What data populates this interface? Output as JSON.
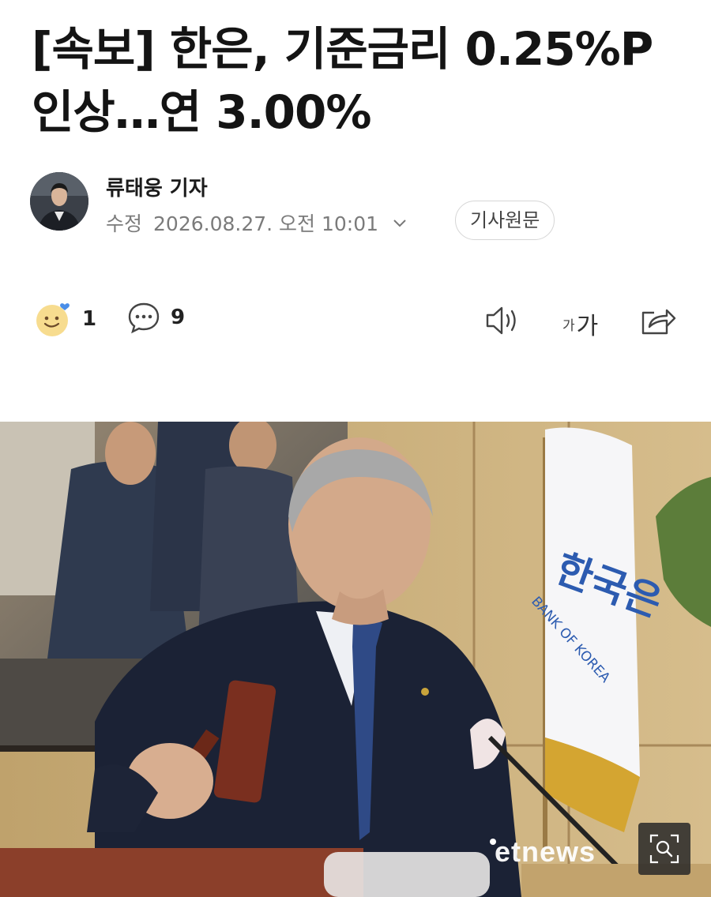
{
  "article": {
    "headline_line1": "[속보] 한은, 기준금리 0.25%P",
    "headline_line2": "인상…연 3.00%"
  },
  "byline": {
    "reporter": "류태웅 기자",
    "edit_label": "수정",
    "timestamp": "2026.08.27. 오전 10:01",
    "original_button": "기사원문"
  },
  "toolbar": {
    "reaction_count": "1",
    "comment_count": "9",
    "font_size_small": "가",
    "font_size_large": "가"
  },
  "photo": {
    "watermark": "etnews",
    "flag_text_ko": "한국은",
    "flag_text_en": "BANK OF KOREA"
  },
  "colors": {
    "background": "#ffffff",
    "headline": "#141414",
    "meta_gray": "#7b7b7b",
    "icon_gray": "#555555"
  },
  "icons": [
    "smile-reaction-icon",
    "comment-icon",
    "chevron-down-icon",
    "speaker-icon",
    "share-icon",
    "zoom-icon"
  ]
}
